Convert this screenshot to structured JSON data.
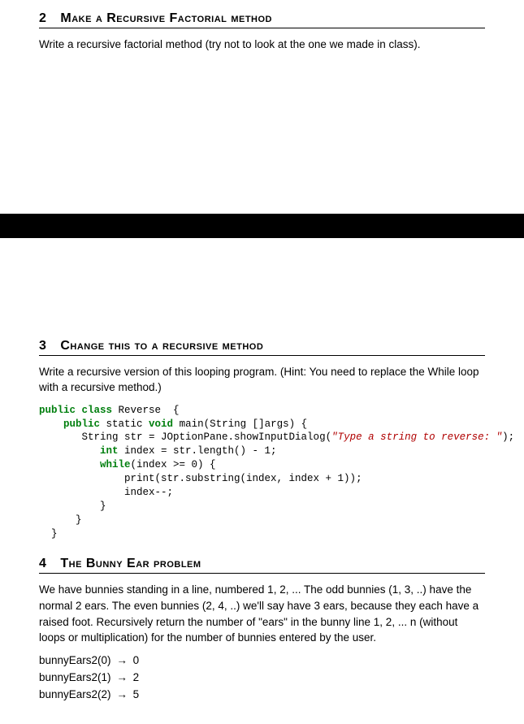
{
  "section2": {
    "num": "2",
    "title": "Make a Recursive Factorial method",
    "body": "Write a recursive factorial method (try not to look at the one we made in class)."
  },
  "section3": {
    "num": "3",
    "title": "Change this to a recursive method",
    "body": "Write a recursive version of this looping program. (Hint: You need to replace the While loop with a recursive method.)",
    "code": {
      "l1_kw1": "public class",
      "l1_name": " Reverse  {",
      "l2_pad": "    ",
      "l2_kw1": "public",
      "l2_mid": " static ",
      "l2_kw2": "void",
      "l2_rest": " main(String []args) {",
      "l3_pad": "       ",
      "l3_a": "String str = JOptionPane.showInputDialog(",
      "l3_str": "\"Type a string to reverse: \"",
      "l3_b": ");",
      "l4_pad": "          ",
      "l4_kw": "int",
      "l4_rest": " index = str.length() - 1;",
      "l5_pad": "          ",
      "l5_kw": "while",
      "l5_rest": "(index >= 0) {",
      "l6": "              print(str.substring(index, index + 1));",
      "l7": "              index--;",
      "l8": "          }",
      "l9": "      }",
      "l10": "  }"
    }
  },
  "section4": {
    "num": "4",
    "title": "The Bunny Ear problem",
    "body": "We have bunnies standing in a line, numbered 1, 2, ... The odd bunnies (1, 3, ..) have the normal 2 ears. The even bunnies (2, 4, ..) we'll say have 3 ears, because they each have a raised foot. Recursively return the number of \"ears\" in the bunny line 1, 2, ... n (without loops or multiplication) for the number of bunnies entered by the user.",
    "arrow": "→",
    "examples": [
      {
        "call": "bunnyEars2(0)",
        "result": "0"
      },
      {
        "call": "bunnyEars2(1)",
        "result": "2"
      },
      {
        "call": "bunnyEars2(2)",
        "result": "5"
      }
    ]
  }
}
